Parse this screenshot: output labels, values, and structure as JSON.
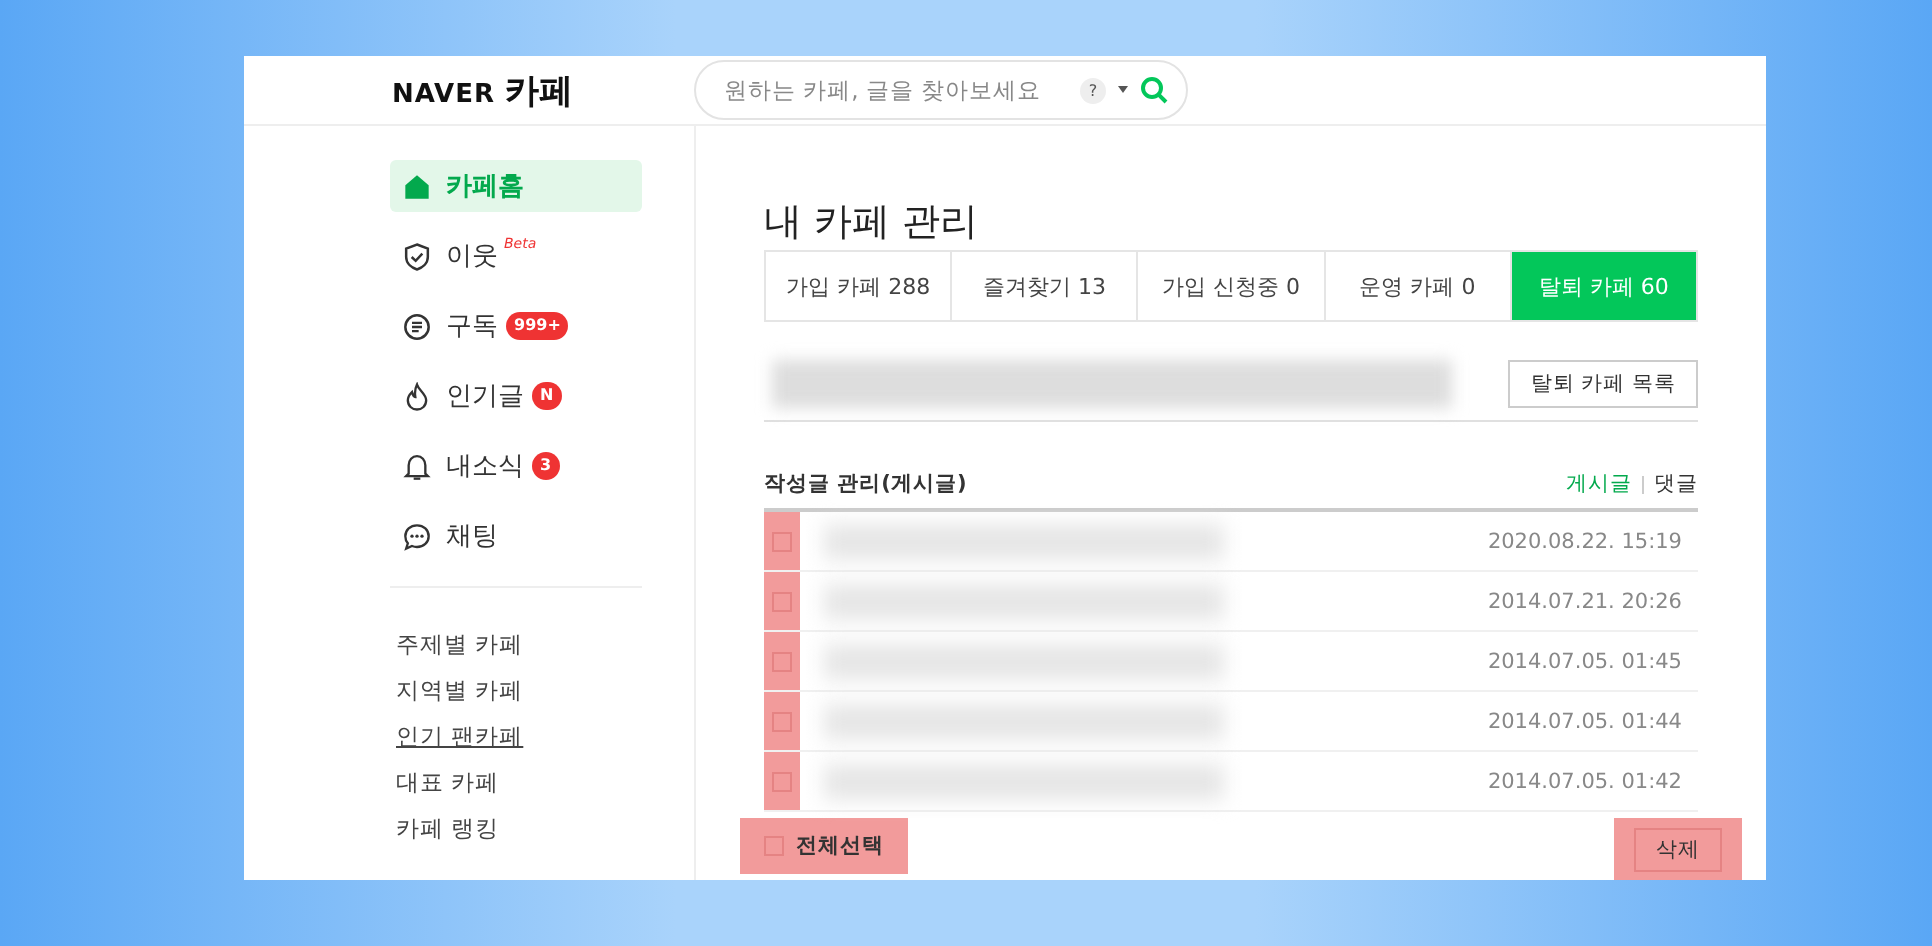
{
  "header": {
    "logo": {
      "brand": "NAVER",
      "service": "카페"
    },
    "search": {
      "placeholder": "원하는 카페, 글을 찾아보세요",
      "help": "?"
    }
  },
  "sidebar": {
    "nav": [
      {
        "label": "카페홈",
        "selected": true
      },
      {
        "label": "이웃",
        "selected": false,
        "tag": "Beta"
      },
      {
        "label": "구독",
        "selected": false,
        "badge": "999+"
      },
      {
        "label": "인기글",
        "selected": false,
        "badge": "N"
      },
      {
        "label": "내소식",
        "selected": false,
        "badge": "3"
      },
      {
        "label": "채팅",
        "selected": false
      }
    ],
    "links": [
      {
        "label": "주제별 카페",
        "underlined": false
      },
      {
        "label": "지역별 카페",
        "underlined": false
      },
      {
        "label": "인기 팬카페",
        "underlined": true
      },
      {
        "label": "대표 카페",
        "underlined": false
      },
      {
        "label": "카페 랭킹",
        "underlined": false
      }
    ]
  },
  "main": {
    "title": "내 카페 관리",
    "tabs": [
      {
        "label": "가입 카페 288",
        "selected": false
      },
      {
        "label": "즐겨찾기 13",
        "selected": false
      },
      {
        "label": "가입 신청중 0",
        "selected": false
      },
      {
        "label": "운영 카페 0",
        "selected": false
      },
      {
        "label": "탈퇴 카페 60",
        "selected": true
      }
    ],
    "list_button": "탈퇴 카페 목록",
    "section_title": "작성글 관리(게시글)",
    "view_toggle": [
      {
        "label": "게시글",
        "selected": true
      },
      {
        "label": "댓글",
        "selected": false
      }
    ],
    "checkbox_column_highlighted": true,
    "posts": [
      {
        "date": "2020.08.22. 15:19",
        "checked": false
      },
      {
        "date": "2014.07.21. 20:26",
        "checked": false
      },
      {
        "date": "2014.07.05. 01:45",
        "checked": false
      },
      {
        "date": "2014.07.05. 01:44",
        "checked": false
      },
      {
        "date": "2014.07.05. 01:42",
        "checked": false
      }
    ],
    "select_all": {
      "label": "전체선택",
      "checked": false,
      "highlighted": true
    },
    "delete_button": {
      "label": "삭제",
      "highlighted": true
    }
  }
}
